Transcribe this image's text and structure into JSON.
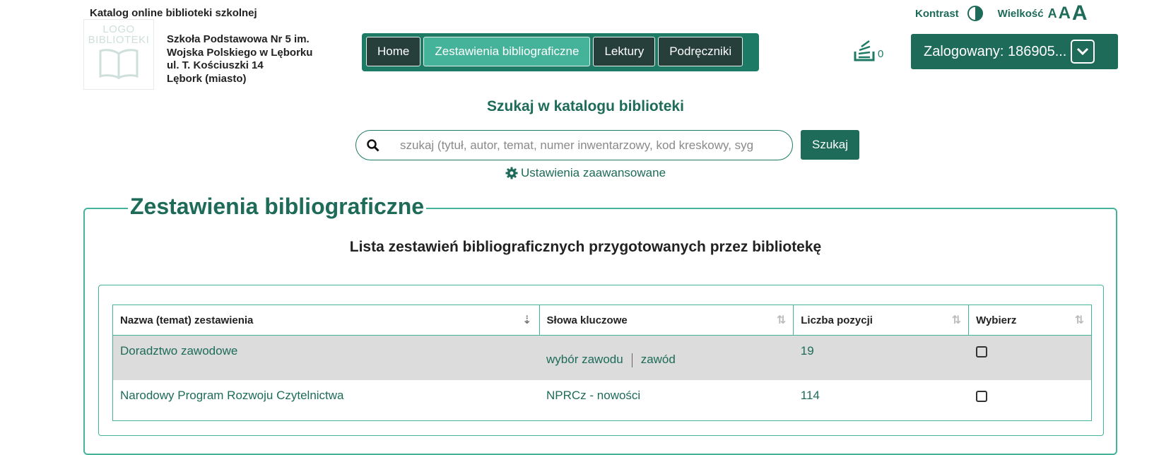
{
  "header": {
    "catalog_title": "Katalog online biblioteki szkolnej",
    "logo_text": "LOGO BIBLIOTEKI",
    "school_lines": [
      "Szkoła Podstawowa Nr 5 im.",
      "Wojska Polskiego w Lęborku",
      "ul. T. Kościuszki 14",
      "Lębork (miasto)"
    ],
    "contrast_label": "Kontrast",
    "size_label": "Wielkość",
    "size_letters": [
      "A",
      "A",
      "A"
    ],
    "basket_count": "0",
    "logged_label": "Zalogowany: 186905..."
  },
  "nav": {
    "items": [
      "Home",
      "Zestawienia bibliograficzne",
      "Lektury",
      "Podręczniki"
    ],
    "active_index": 1
  },
  "search": {
    "heading": "Szukaj w katalogu biblioteki",
    "placeholder": "szukaj (tytuł, autor, temat, numer inwentarzowy, kod kreskowy, syg",
    "button": "Szukaj",
    "advanced": "Ustawienia zaawansowane"
  },
  "main": {
    "legend": "Zestawienia bibliograficzne",
    "subtitle": "Lista zestawień bibliograficznych przygotowanych przez bibliotekę",
    "columns": [
      "Nazwa (temat) zestawienia",
      "Słowa kluczowe",
      "Liczba pozycji",
      "Wybierz"
    ],
    "rows": [
      {
        "name": "Doradztwo zawodowe",
        "keywords": [
          "wybór zawodu",
          "zawód"
        ],
        "count": "19"
      },
      {
        "name": "Narodowy Program Rozwoju Czytelnictwa",
        "keywords": [
          "NPRCz - nowości"
        ],
        "count": "114"
      }
    ]
  },
  "colors": {
    "brand": "#1d6b58",
    "accent": "#45b29a",
    "nav_dark": "#273f3a"
  },
  "icons": [
    "contrast-icon",
    "basket-icon",
    "chevron-down-icon",
    "search-icon",
    "gear-icon",
    "sort-icon",
    "checkbox-icon"
  ]
}
